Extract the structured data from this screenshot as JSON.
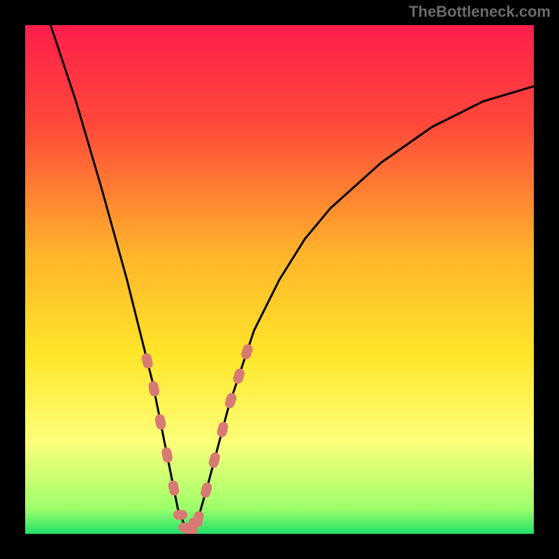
{
  "branding": {
    "watermark": "TheBottleneck.com"
  },
  "chart_data": {
    "type": "line",
    "title": "",
    "xlabel": "",
    "ylabel": "",
    "xlim": [
      0,
      100
    ],
    "ylim": [
      0,
      100
    ],
    "grid": false,
    "legend": false,
    "optimum_x": 32,
    "highlight_band": {
      "y_low": 0,
      "y_high": 5,
      "note": "green band indicating ideal zone (≈0% bottleneck)"
    },
    "series": [
      {
        "name": "bottleneck-curve",
        "x": [
          5,
          10,
          15,
          20,
          25,
          28,
          30,
          32,
          34,
          36,
          40,
          45,
          50,
          55,
          60,
          70,
          80,
          90,
          100
        ],
        "values": [
          100,
          85,
          68,
          50,
          30,
          15,
          5,
          0,
          3,
          10,
          25,
          40,
          50,
          58,
          64,
          73,
          80,
          85,
          88
        ]
      }
    ],
    "annotations": {
      "dotted_segments_note": "salmon dotted overlay on both flanks of the valley roughly between y=5 and y=35",
      "left_dotted_range": {
        "x_start": 24,
        "x_end": 30
      },
      "right_dotted_range": {
        "x_start": 34,
        "x_end": 44
      }
    },
    "background": {
      "type": "vertical-gradient",
      "stops": [
        {
          "pos": 0.0,
          "color": "#ff1f4b"
        },
        {
          "pos": 0.2,
          "color": "#ff4a3a"
        },
        {
          "pos": 0.45,
          "color": "#ffb42a"
        },
        {
          "pos": 0.65,
          "color": "#ffe62a"
        },
        {
          "pos": 0.82,
          "color": "#fcff7a"
        },
        {
          "pos": 0.95,
          "color": "#9eff6a"
        },
        {
          "pos": 1.0,
          "color": "#22e06a"
        }
      ]
    },
    "curve_color": "#000000",
    "dots_color": "#d87a74"
  }
}
